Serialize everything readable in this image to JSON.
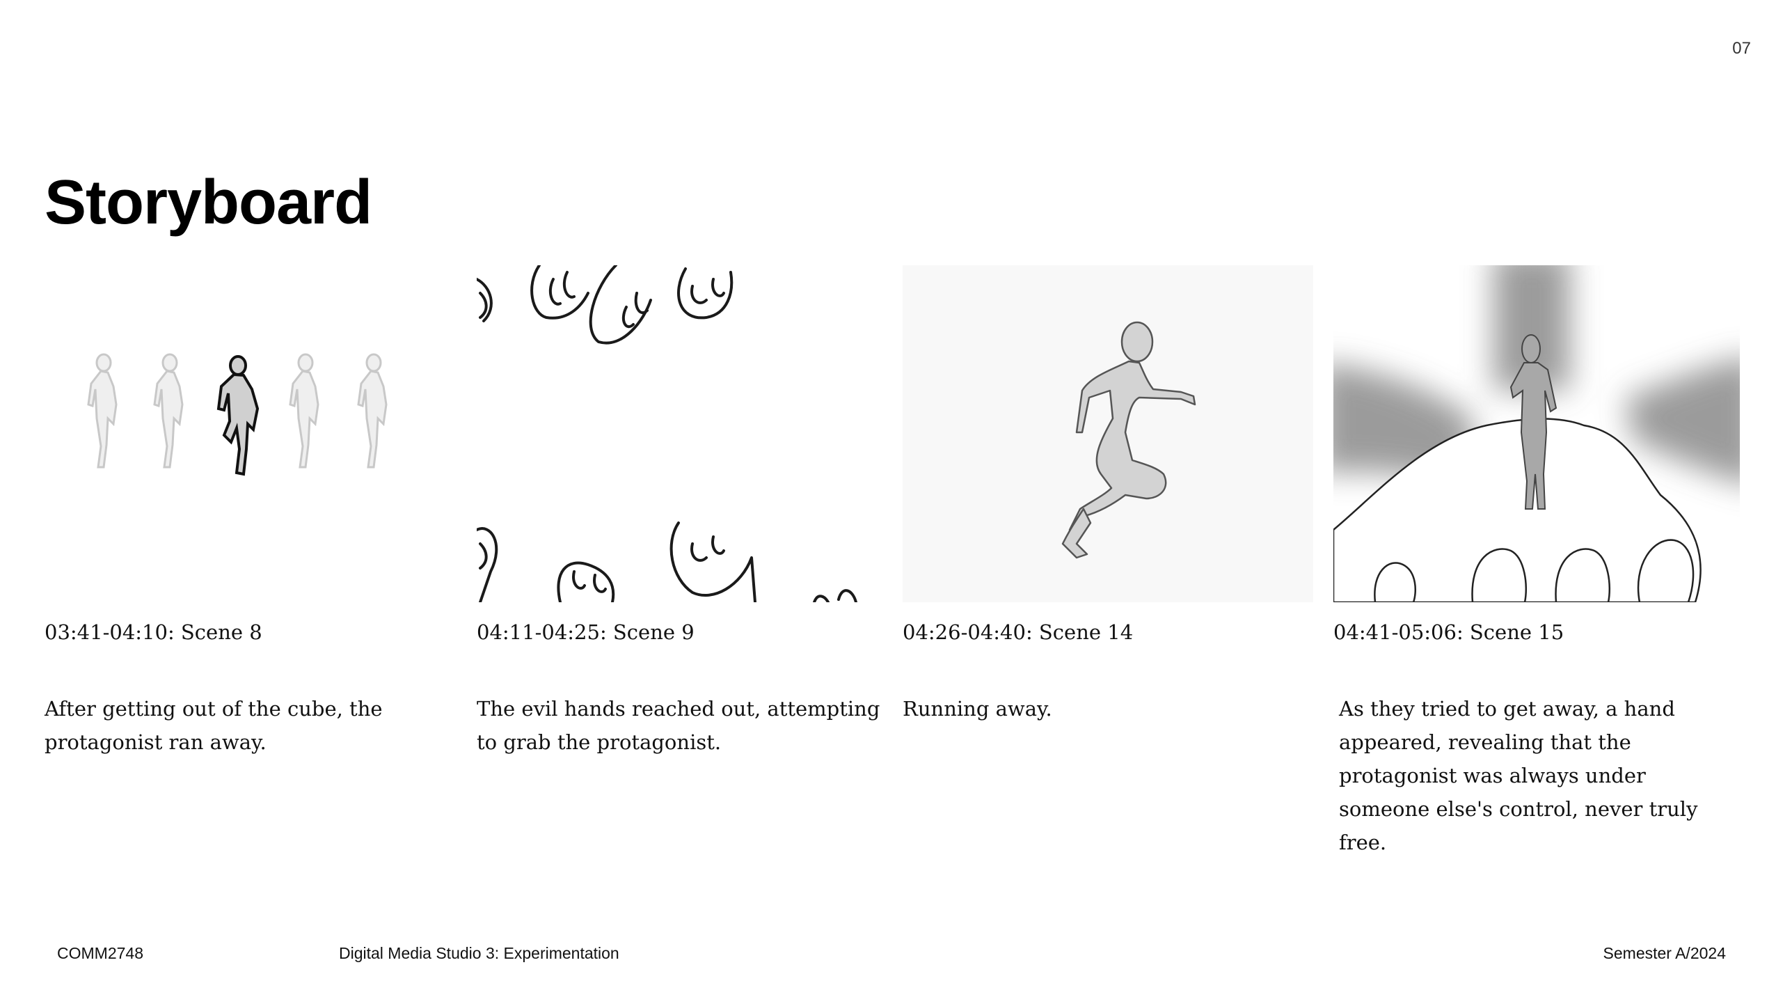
{
  "page_number": "07",
  "title": "Storyboard",
  "panels": [
    {
      "timecode": "03:41-04:10: Scene 8",
      "description": "After getting out of the cube, the protagonist ran away.",
      "image_icon": "running-figures-sketch-icon"
    },
    {
      "timecode": "04:11-04:25: Scene 9",
      "description": "The evil hands reached out, attempting to grab the protagonist.",
      "image_icon": "reaching-hands-sketch-icon"
    },
    {
      "timecode": "04:26-04:40: Scene 14",
      "description": "Running away.",
      "image_icon": "running-person-sketch-icon"
    },
    {
      "timecode": "04:41-05:06: Scene 15",
      "description": "As they tried to get away, a hand appeared, revealing that the protagonist was always under someone else's control, never truly free.",
      "image_icon": "figure-on-giant-hand-sketch-icon"
    }
  ],
  "footer": {
    "course_code": "COMM2748",
    "course_name": "Digital Media Studio 3: Experimentation",
    "semester": "Semester A/2024"
  },
  "colors": {
    "text": "#111111",
    "sketch_line": "#1a1a1a",
    "ghost_figure": "#c8c8c8",
    "panel_bg": "#f8f8f8"
  }
}
